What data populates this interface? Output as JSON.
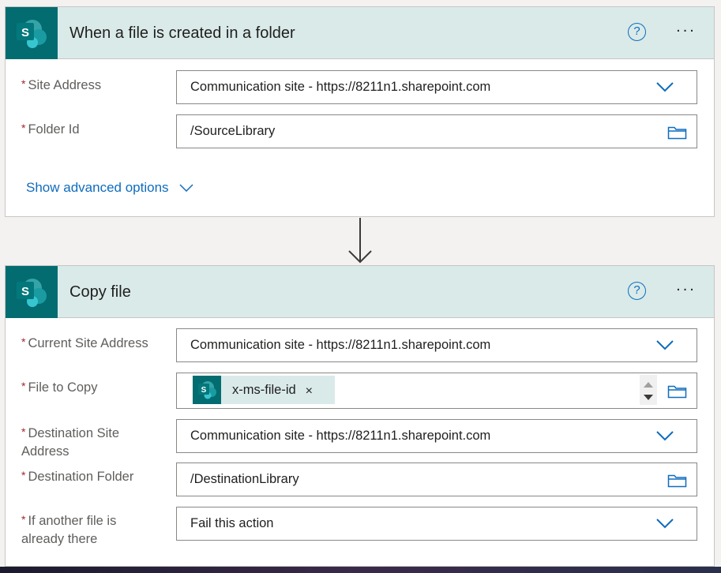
{
  "trigger": {
    "title": "When a file is created in a folder",
    "help_icon": "?",
    "more_icon": "...",
    "site_address": {
      "label": "Site Address",
      "value": "Communication site - https://8211n1.sharepoint.com"
    },
    "folder_id": {
      "label": "Folder Id",
      "value": "/SourceLibrary"
    },
    "advanced_label": "Show advanced options"
  },
  "action": {
    "title": "Copy file",
    "help_icon": "?",
    "more_icon": "...",
    "current_site": {
      "label": "Current Site Address",
      "value": "Communication site - https://8211n1.sharepoint.com"
    },
    "file_to_copy": {
      "label": "File to Copy",
      "token": "x-ms-file-id",
      "token_remove": "×"
    },
    "dest_site": {
      "label_line1": "Destination Site",
      "label_line2": "Address",
      "value": "Communication site - https://8211n1.sharepoint.com"
    },
    "dest_folder": {
      "label": "Destination Folder",
      "value": "/DestinationLibrary"
    },
    "if_exists": {
      "label_line1": "If another file is",
      "label_line2": "already there",
      "value": "Fail this action"
    }
  },
  "required_marker": "*",
  "logo_letter": "S",
  "colors": {
    "sharepoint": "#036c70",
    "header_bg": "#d9eae9",
    "accent_blue": "#0f6cbd",
    "required_red": "#a4262c"
  }
}
